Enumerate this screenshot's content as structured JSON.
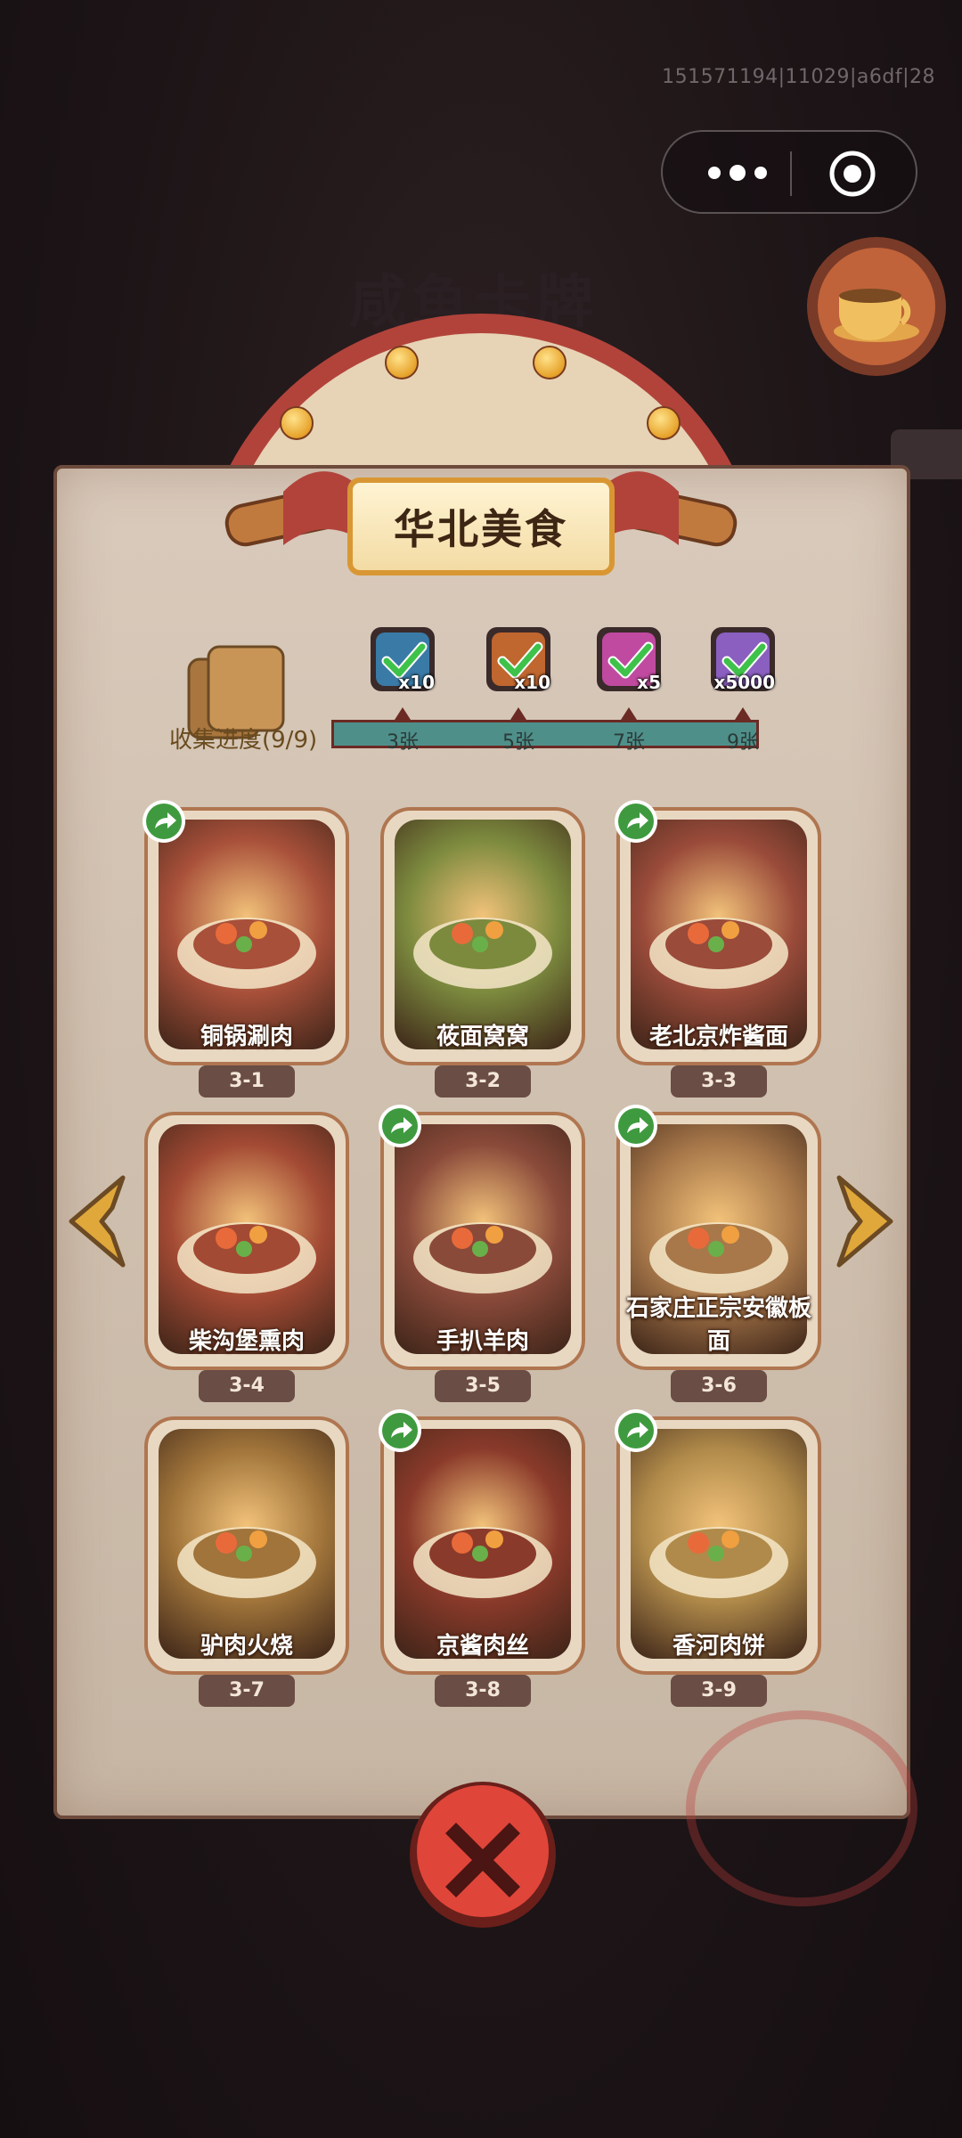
{
  "status": {
    "build_id": "151571194|11029|a6df|28"
  },
  "capsule": {
    "more_icon": "more-dots-icon",
    "target_icon": "target-icon"
  },
  "background": {
    "game_title": "咸鱼卡牌"
  },
  "panel": {
    "title": "华北美食",
    "progress_label": "收集进度(9/9)",
    "milestones": [
      {
        "label": "3张",
        "reward_count": "x10",
        "reward_color": "#3a7aa6",
        "claimed": true
      },
      {
        "label": "5张",
        "reward_count": "x10",
        "reward_color": "#c0662f",
        "claimed": true
      },
      {
        "label": "7张",
        "reward_count": "x5",
        "reward_color": "#c04aa0",
        "claimed": true
      },
      {
        "label": "9张",
        "reward_count": "x5000",
        "reward_color": "#8a5fc0",
        "claimed": true
      }
    ],
    "progress_fraction": 1.0
  },
  "cards": [
    {
      "name": "铜锅涮肉",
      "code": "3-1",
      "shared": true,
      "art": "#a8503a"
    },
    {
      "name": "莜面窝窝",
      "code": "3-2",
      "shared": false,
      "art": "#7c8a3e"
    },
    {
      "name": "老北京炸酱面",
      "code": "3-3",
      "shared": true,
      "art": "#9a4b3a"
    },
    {
      "name": "柴沟堡熏肉",
      "code": "3-4",
      "shared": false,
      "art": "#a34a34"
    },
    {
      "name": "手扒羊肉",
      "code": "3-5",
      "shared": true,
      "art": "#8a4a3a"
    },
    {
      "name": "石家庄正宗安徽板面",
      "code": "3-6",
      "shared": true,
      "art": "#a8784a"
    },
    {
      "name": "驴肉火烧",
      "code": "3-7",
      "shared": false,
      "art": "#a0743a"
    },
    {
      "name": "京酱肉丝",
      "code": "3-8",
      "shared": true,
      "art": "#8a3a2a"
    },
    {
      "name": "香河肉饼",
      "code": "3-9",
      "shared": true,
      "art": "#b08a4a"
    }
  ],
  "colors": {
    "accent_red": "#e0453a",
    "share_green": "#3f9a3f",
    "frame_brown": "#b07650"
  }
}
